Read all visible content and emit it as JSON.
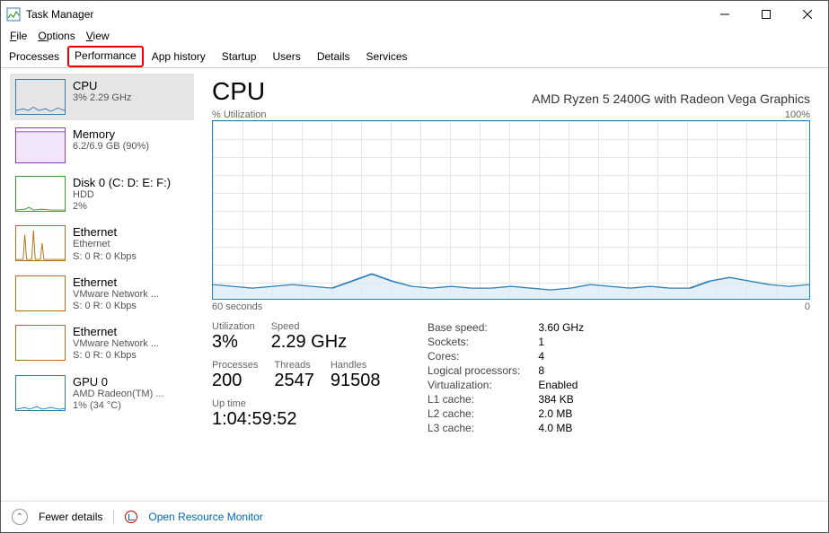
{
  "window": {
    "title": "Task Manager"
  },
  "menu": {
    "file": "File",
    "options": "Options",
    "view": "View"
  },
  "tabs": {
    "processes": "Processes",
    "performance": "Performance",
    "app_history": "App history",
    "startup": "Startup",
    "users": "Users",
    "details": "Details",
    "services": "Services"
  },
  "sidebar": [
    {
      "title": "CPU",
      "sub1": "3%  2.29 GHz",
      "sub2": "",
      "color": "#2d7fb8"
    },
    {
      "title": "Memory",
      "sub1": "6.2/6.9 GB (90%)",
      "sub2": "",
      "color": "#8b3db5"
    },
    {
      "title": "Disk 0 (C: D: E: F:)",
      "sub1": "HDD",
      "sub2": "2%",
      "color": "#3a9b35"
    },
    {
      "title": "Ethernet",
      "sub1": "Ethernet",
      "sub2": "S: 0  R: 0 Kbps",
      "color": "#b76e17"
    },
    {
      "title": "Ethernet",
      "sub1": "VMware Network ...",
      "sub2": "S: 0  R: 0 Kbps",
      "color": "#b76e17"
    },
    {
      "title": "Ethernet",
      "sub1": "VMware Network ...",
      "sub2": "S: 0  R: 0 Kbps",
      "color": "#b76e17"
    },
    {
      "title": "GPU 0",
      "sub1": "AMD Radeon(TM) ...",
      "sub2": "1% (34 °C)",
      "color": "#2d7fb8"
    }
  ],
  "main": {
    "title": "CPU",
    "subtitle": "AMD Ryzen 5 2400G with Radeon Vega Graphics",
    "top_left_label": "% Utilization",
    "top_right_label": "100%",
    "bottom_left_label": "60 seconds",
    "bottom_right_label": "0"
  },
  "stats": {
    "utilization_label": "Utilization",
    "utilization": "3%",
    "speed_label": "Speed",
    "speed": "2.29 GHz",
    "processes_label": "Processes",
    "processes": "200",
    "threads_label": "Threads",
    "threads": "2547",
    "handles_label": "Handles",
    "handles": "91508",
    "uptime_label": "Up time",
    "uptime": "1:04:59:52"
  },
  "details": {
    "base_speed_label": "Base speed:",
    "base_speed": "3.60 GHz",
    "sockets_label": "Sockets:",
    "sockets": "1",
    "cores_label": "Cores:",
    "cores": "4",
    "logical_label": "Logical processors:",
    "logical": "8",
    "virtualization_label": "Virtualization:",
    "virtualization": "Enabled",
    "l1_label": "L1 cache:",
    "l1": "384 KB",
    "l2_label": "L2 cache:",
    "l2": "2.0 MB",
    "l3_label": "L3 cache:",
    "l3": "4.0 MB"
  },
  "footer": {
    "fewer_details": "Fewer details",
    "open_rm": "Open Resource Monitor"
  },
  "chart_data": {
    "type": "area",
    "title": "% Utilization",
    "xlabel": "seconds",
    "ylabel": "% Utilization",
    "xlim": [
      0,
      60
    ],
    "ylim": [
      0,
      100
    ],
    "x_seconds_ago": [
      60,
      58,
      56,
      54,
      52,
      50,
      48,
      46,
      44,
      42,
      40,
      38,
      36,
      34,
      32,
      30,
      28,
      26,
      24,
      22,
      20,
      18,
      16,
      14,
      12,
      10,
      8,
      6,
      4,
      2,
      0
    ],
    "values_pct": [
      8,
      7,
      6,
      7,
      8,
      7,
      6,
      10,
      14,
      10,
      7,
      6,
      7,
      6,
      6,
      7,
      6,
      5,
      6,
      8,
      7,
      6,
      7,
      6,
      6,
      10,
      12,
      10,
      8,
      7,
      8
    ]
  }
}
